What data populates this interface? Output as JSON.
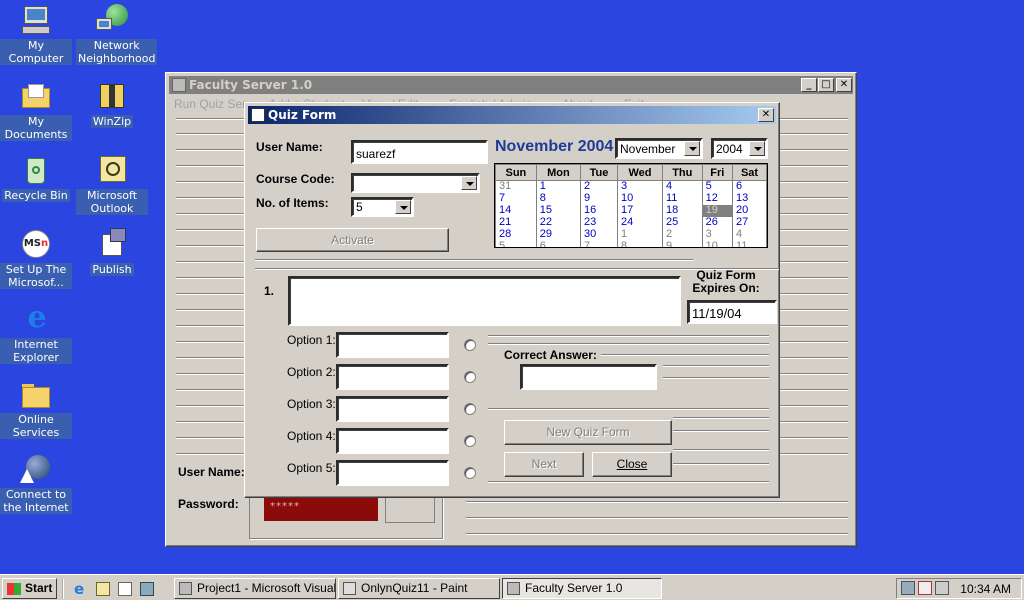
{
  "desktop": {
    "icons": [
      {
        "label": "My Computer"
      },
      {
        "label": "Network Neighborhood"
      },
      {
        "label": "My Documents"
      },
      {
        "label": "WinZip"
      },
      {
        "label": "Recycle Bin"
      },
      {
        "label": "Microsoft Outlook"
      },
      {
        "label": "Set Up The Microsof..."
      },
      {
        "label": "Publish"
      },
      {
        "label": "Internet Explorer"
      },
      {
        "label": "Online Services"
      },
      {
        "label": "Connect to the Internet"
      }
    ]
  },
  "main_window": {
    "title": "Faculty Server 1.0",
    "menu": [
      "Run Quiz Serv",
      "Add a Student",
      "View / Edit ...",
      "English / Admin ...",
      "About ...",
      "Exit"
    ],
    "username_label": "User Name:",
    "password_label": "Password:",
    "password_value": "*****"
  },
  "quiz_form": {
    "title": "Quiz Form",
    "user_name_label": "User Name:",
    "user_name_value": "suarezf",
    "course_code_label": "Course Code:",
    "course_code_value": "",
    "no_items_label": "No. of Items:",
    "no_items_value": "5",
    "activate_label": "Activate",
    "question_number": "1.",
    "question_text": "",
    "expires_label": "Quiz Form Expires On:",
    "expires_value": "11/19/04",
    "options": [
      {
        "label": "Option 1:",
        "value": ""
      },
      {
        "label": "Option 2:",
        "value": ""
      },
      {
        "label": "Option 3:",
        "value": ""
      },
      {
        "label": "Option 4:",
        "value": ""
      },
      {
        "label": "Option 5:",
        "value": ""
      }
    ],
    "correct_answer_label": "Correct Answer:",
    "correct_answer_value": "",
    "new_quiz_form_label": "New Quiz Form",
    "next_label": "Next",
    "close_label": "Close",
    "calendar": {
      "heading": "November 2004",
      "month_select": "November",
      "year_select": "2004",
      "weekdays": [
        "Sun",
        "Mon",
        "Tue",
        "Wed",
        "Thu",
        "Fri",
        "Sat"
      ],
      "weeks": [
        [
          "31",
          "1",
          "2",
          "3",
          "4",
          "5",
          "6"
        ],
        [
          "7",
          "8",
          "9",
          "10",
          "11",
          "12",
          "13"
        ],
        [
          "14",
          "15",
          "16",
          "17",
          "18",
          "19",
          "20"
        ],
        [
          "21",
          "22",
          "23",
          "24",
          "25",
          "26",
          "27"
        ],
        [
          "28",
          "29",
          "30",
          "1",
          "2",
          "3",
          "4"
        ],
        [
          "5",
          "6",
          "7",
          "8",
          "9",
          "10",
          "11"
        ]
      ],
      "selected": "19"
    }
  },
  "taskbar": {
    "start_label": "Start",
    "tasks": [
      {
        "label": "Project1 - Microsoft Visual..."
      },
      {
        "label": "OnlynQuiz11 - Paint"
      },
      {
        "label": "Faculty Server 1.0"
      }
    ],
    "clock": "10:34 AM"
  },
  "colors": {
    "desktop": "#2b45e0",
    "active_title": "#0a246a",
    "password_field": "#8b0a0a"
  }
}
